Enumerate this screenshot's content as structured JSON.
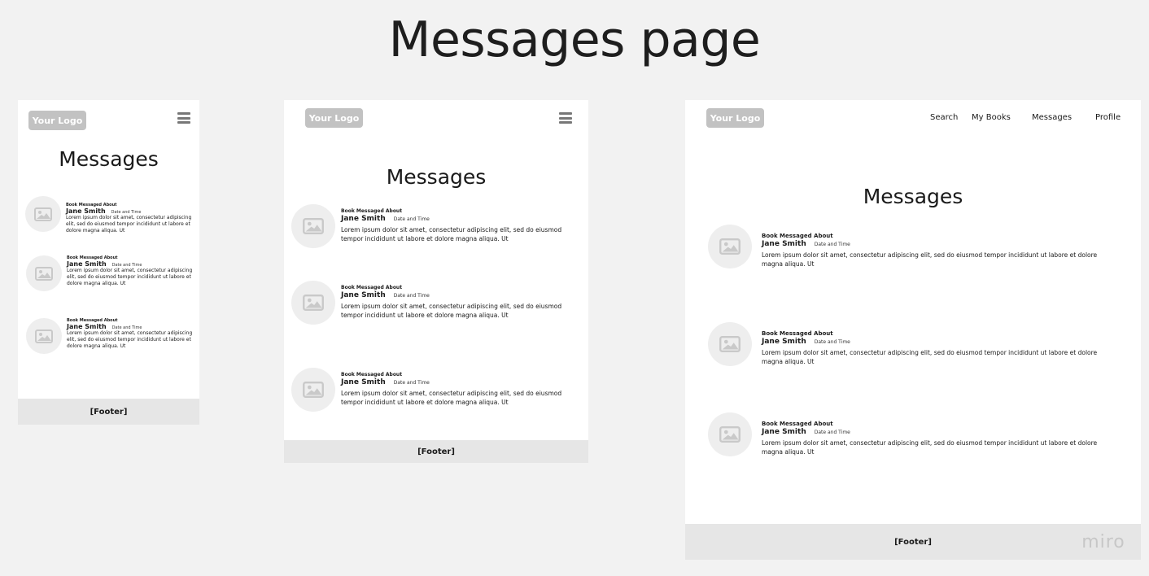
{
  "board_title": "Messages page",
  "mobile": {
    "logo": "Your Logo",
    "heading": "Messages",
    "footer": "[Footer]",
    "messages": [
      {
        "book": "Book Messaged About",
        "name": "Jane Smith",
        "datetime": "Date and Time",
        "text": "Lorem ipsum dolor sit amet, consectetur adipiscing elit, sed do eiusmod tempor incididunt ut labore et dolore magna aliqua. Ut"
      },
      {
        "book": "Book Messaged About",
        "name": "Jane Smith",
        "datetime": "Date and Time",
        "text": "Lorem ipsum dolor sit amet, consectetur adipiscing elit, sed do eiusmod tempor incididunt ut labore et dolore magna aliqua. Ut"
      },
      {
        "book": "Book Messaged About",
        "name": "Jane Smith",
        "datetime": "Date and Time",
        "text": "Lorem ipsum dolor sit amet, consectetur adipiscing elit, sed do eiusmod tempor incididunt ut labore et dolore magna aliqua. Ut"
      }
    ]
  },
  "tablet": {
    "logo": "Your Logo",
    "heading": "Messages",
    "footer": "[Footer]",
    "messages": [
      {
        "book": "Book Messaged About",
        "name": "Jane Smith",
        "datetime": "Date and Time",
        "text": "Lorem ipsum dolor sit amet, consectetur adipiscing elit, sed do eiusmod tempor incididunt ut labore et dolore magna aliqua. Ut"
      },
      {
        "book": "Book Messaged About",
        "name": "Jane Smith",
        "datetime": "Date and Time",
        "text": "Lorem ipsum dolor sit amet, consectetur adipiscing elit, sed do eiusmod tempor incididunt ut labore et dolore magna aliqua. Ut"
      },
      {
        "book": "Book Messaged About",
        "name": "Jane Smith",
        "datetime": "Date and Time",
        "text": "Lorem ipsum dolor sit amet, consectetur adipiscing elit, sed do eiusmod tempor incididunt ut labore et dolore magna aliqua. Ut"
      }
    ]
  },
  "desktop": {
    "logo": "Your Logo",
    "nav": [
      "Search",
      "My Books",
      "Messages",
      "Profile"
    ],
    "heading": "Messages",
    "footer": "[Footer]",
    "messages": [
      {
        "book": "Book Messaged About",
        "name": "Jane Smith",
        "datetime": "Date and Time",
        "text": "Lorem ipsum dolor sit amet, consectetur adipiscing elit, sed do eiusmod tempor incididunt ut labore et dolore magna aliqua. Ut"
      },
      {
        "book": "Book Messaged About",
        "name": "Jane Smith",
        "datetime": "Date and Time",
        "text": "Lorem ipsum dolor sit amet, consectetur adipiscing elit, sed do eiusmod tempor incididunt ut labore et dolore magna aliqua. Ut"
      },
      {
        "book": "Book Messaged About",
        "name": "Jane Smith",
        "datetime": "Date and Time",
        "text": "Lorem ipsum dolor sit amet, consectetur adipiscing elit, sed do eiusmod tempor incididunt ut labore et dolore magna aliqua. Ut"
      }
    ]
  },
  "watermark": "miro"
}
